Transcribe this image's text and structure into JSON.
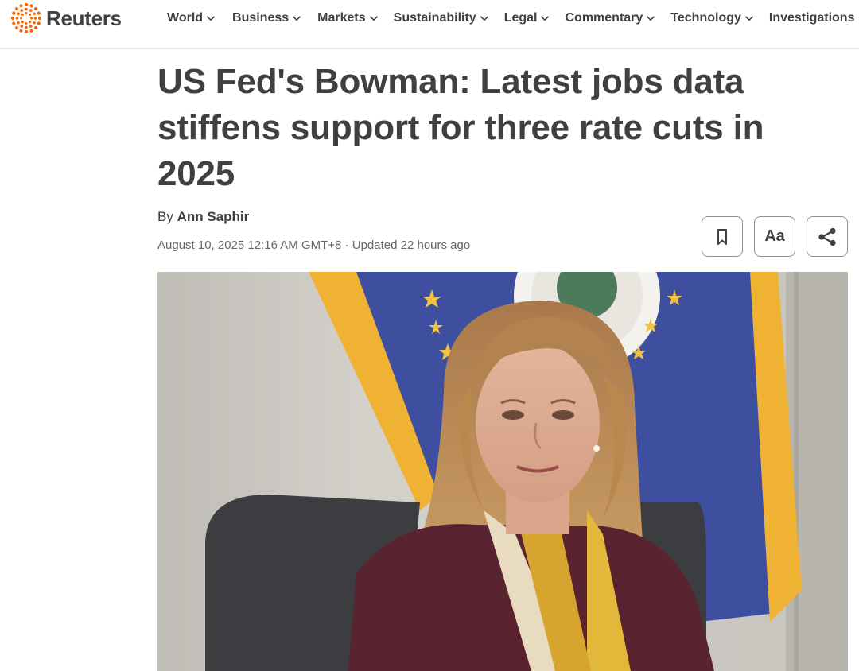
{
  "brand": {
    "name": "Reuters",
    "accent_color": "#fa6400",
    "text_color": "#404040"
  },
  "nav": {
    "items": [
      {
        "label": "World",
        "has_dropdown": true
      },
      {
        "label": "Business",
        "has_dropdown": true
      },
      {
        "label": "Markets",
        "has_dropdown": true
      },
      {
        "label": "Sustainability",
        "has_dropdown": true
      },
      {
        "label": "Legal",
        "has_dropdown": true
      },
      {
        "label": "Commentary",
        "has_dropdown": true
      },
      {
        "label": "Technology",
        "has_dropdown": true
      },
      {
        "label": "Investigations",
        "has_dropdown": false
      }
    ]
  },
  "article": {
    "headline": "US Fed's Bowman: Latest jobs data stiffens support for three rate cuts in 2025",
    "byline_prefix": "By",
    "author": "Ann Saphir",
    "published": "August 10, 2025 12:16 AM GMT+8",
    "separator": "·",
    "updated": "Updated 22 hours ago"
  },
  "tools": {
    "bookmark_icon": "bookmark-icon",
    "font_size_label": "Aa",
    "share_icon": "share-icon"
  },
  "photo": {
    "subject": "portrait-photo",
    "colors": {
      "flag_blue": "#3f4fa0",
      "flag_fringe": "#f0b232",
      "jacket": "#5a2330",
      "wall": "#c9c6c0"
    }
  }
}
